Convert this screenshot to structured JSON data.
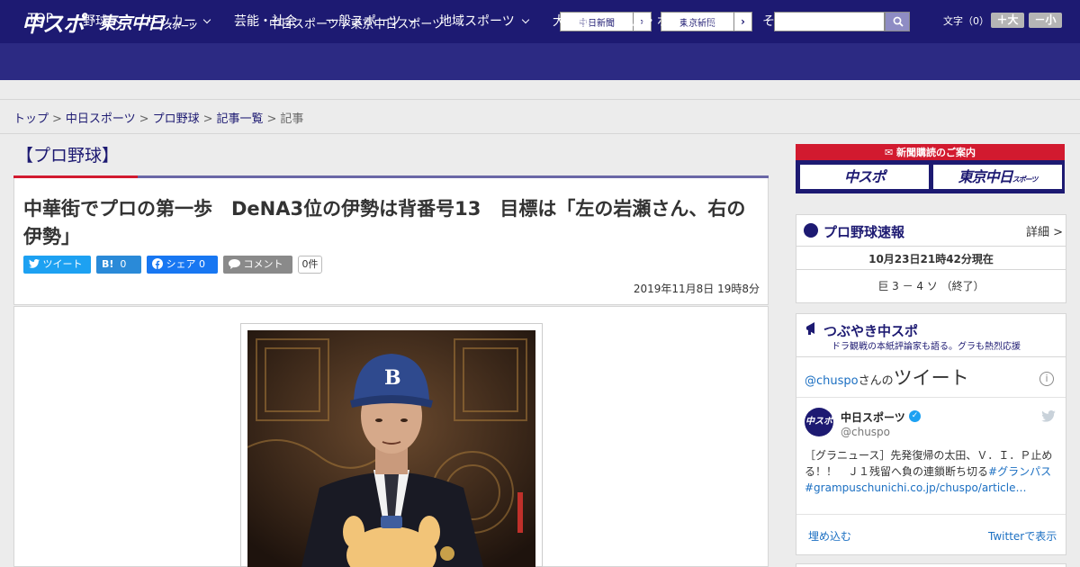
{
  "header": {
    "logo_main": "中スポ",
    "logo_tokyo": "東京中日",
    "logo_tokyo_small": "スポーツ",
    "site_title": "中日スポーツ / 東京中日スポーツ",
    "links": [
      {
        "label": "中日新聞"
      },
      {
        "label": "東京新聞"
      }
    ],
    "search": {
      "value": "",
      "placeholder": ""
    },
    "text_size_label": "文字（0）",
    "size_up": "＋大",
    "size_down": "－小"
  },
  "nav": {
    "items": [
      {
        "label": "TOP"
      },
      {
        "label": "野球"
      },
      {
        "label": "サッカー"
      },
      {
        "label": "芸能・社会"
      },
      {
        "label": "一般スポーツ"
      },
      {
        "label": "地域スポーツ"
      },
      {
        "label": "大相撲"
      },
      {
        "label": "競馬・ボート・競輪"
      },
      {
        "label": "その他"
      }
    ]
  },
  "breadcrumb": {
    "items": [
      "トップ",
      "中日スポーツ",
      "プロ野球",
      "記事一覧"
    ],
    "current": "記事",
    "separator": ">"
  },
  "article": {
    "category": "【プロ野球】",
    "headline": "中華街でプロの第一歩　DeNA3位の伊勢は背番号13　目標は「左の岩瀬さん、右の伊勢」",
    "share": {
      "tweet": "ツイート",
      "hatena_count": "0",
      "facebook": "シェア 0",
      "comment": "コメント",
      "comment_count": "0件"
    },
    "date": "2019年11月8日 19時8分"
  },
  "sidebar": {
    "promo": {
      "title": "新聞購読のご案内",
      "chuspo": "中スポ",
      "tokyo": "東京中日",
      "tokyo_small": "スポーツ"
    },
    "score": {
      "title": "プロ野球速報",
      "more": "詳細 >",
      "time": "10月23日21時42分現在",
      "line": "巨 3 － 4 ソ （終了）"
    },
    "tweets": {
      "title": "つぶやき中スポ",
      "subtitle": "ドラ観戦の本紙評論家も語る。グラも熱烈応援",
      "handle": "@chuspo",
      "handle_suffix": "さんの",
      "handle_label": "ツイート",
      "account_name": "中日スポーツ",
      "screen_name": "@chuspo",
      "tweet_text": "［グラニュース］先発復帰の太田、Ｖ．Ｉ．Ｐ止める！！　Ｊ１残留へ負の連鎖断ち切る",
      "tweet_tag": "#グランパス",
      "tweet_link": "#grampuschunichi.co.jp/chuspo/article…",
      "embed": "埋め込む",
      "view_on_twitter": "Twitterで表示"
    }
  },
  "colors": {
    "brand_navy": "#1d1a72",
    "nav_bg": "#2c2a83",
    "accent_red": "#d21a2f",
    "twitter_blue": "#1da1f2"
  }
}
